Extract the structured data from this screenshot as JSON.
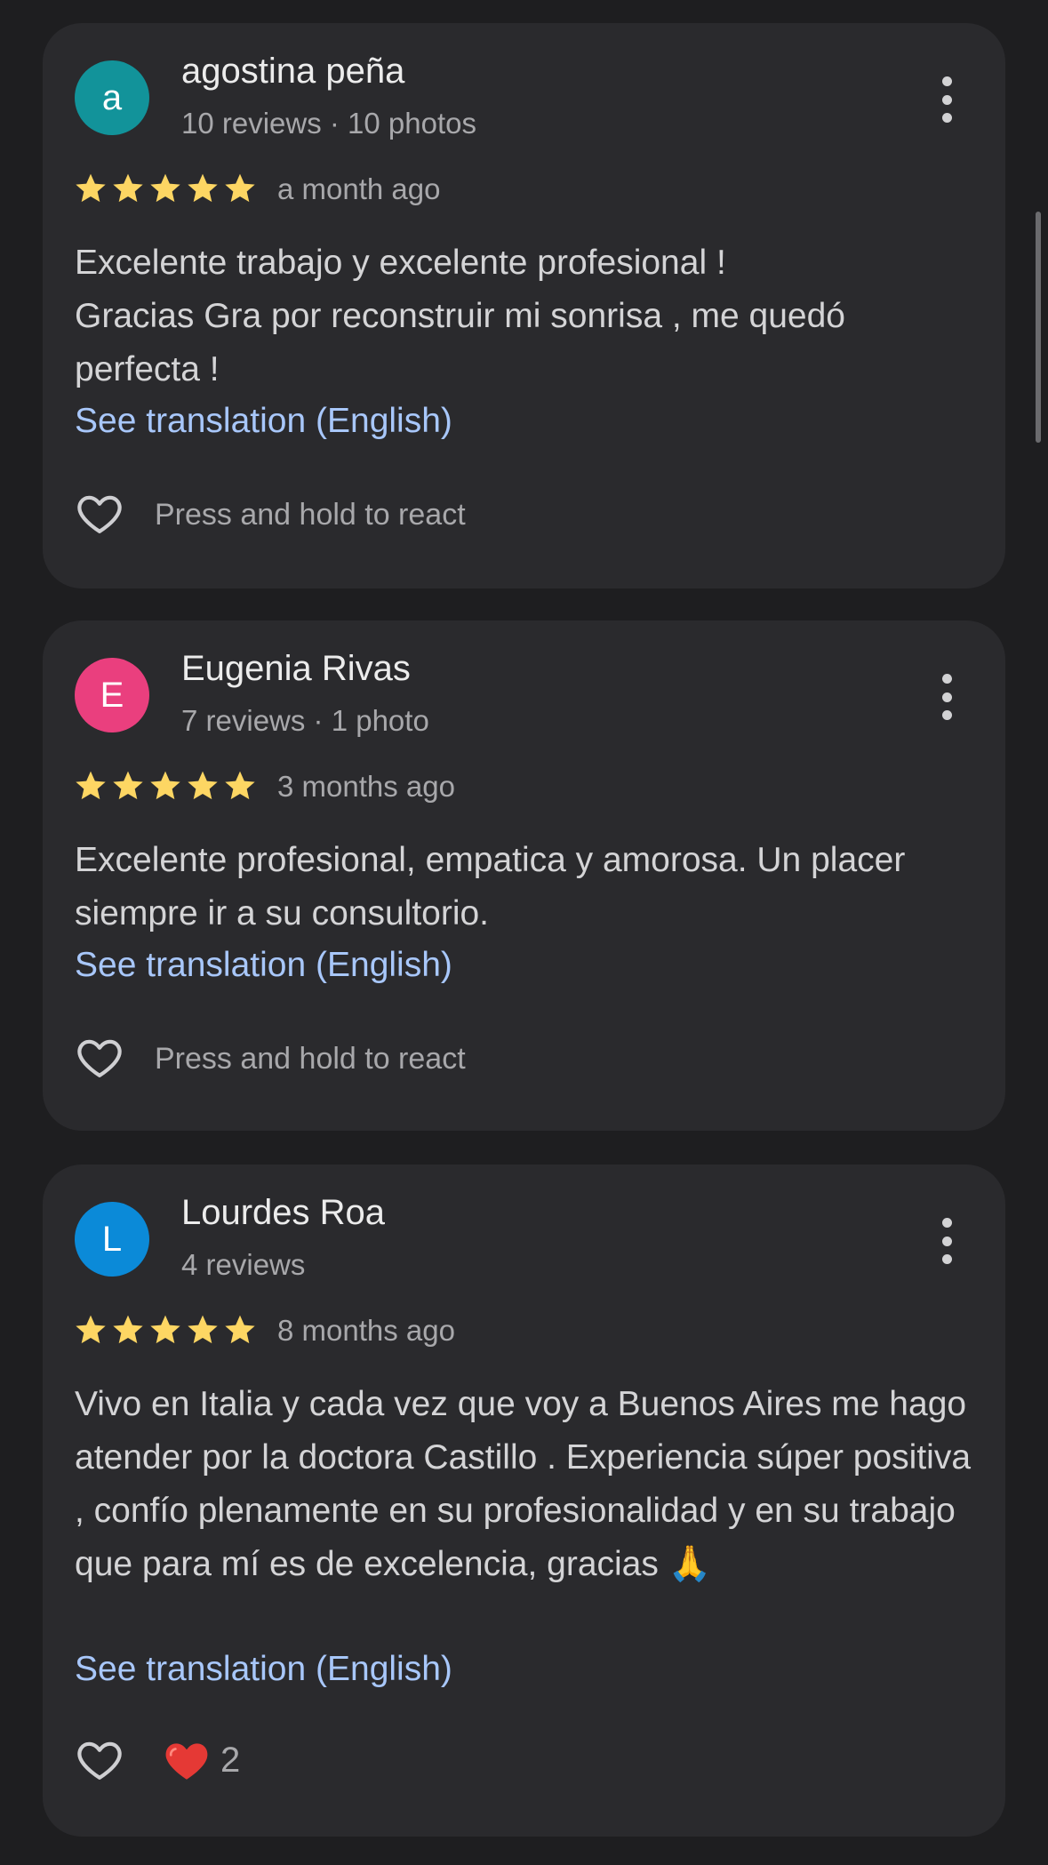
{
  "colors": {
    "background": "#1e1e20",
    "card": "#2a2a2d",
    "star": "#fdd663",
    "link": "#a8c7fa",
    "reaction_heart": "#e53935"
  },
  "reviews": [
    {
      "avatar_letter": "a",
      "avatar_color": "#12939a",
      "name": "agostina peña",
      "meta": "10 reviews · 10 photos",
      "rating": 5,
      "when": "a month ago",
      "text": "Excelente trabajo y excelente profesional !\nGracias Gra por reconstruir mi sonrisa , me quedó perfecta !",
      "translate_label": "See translation (English)",
      "react_label": "Press and hold to react",
      "more_icon": "more-vert-icon",
      "like_icon": "heart-outline-icon"
    },
    {
      "avatar_letter": "E",
      "avatar_color": "#ea3f7e",
      "name": "Eugenia Rivas",
      "meta": "7 reviews · 1 photo",
      "rating": 5,
      "when": "3 months ago",
      "text": "Excelente profesional, empatica y amorosa. Un placer siempre ir a su consultorio.",
      "translate_label": "See translation (English)",
      "react_label": "Press and hold to react",
      "more_icon": "more-vert-icon",
      "like_icon": "heart-outline-icon"
    },
    {
      "avatar_letter": "L",
      "avatar_color": "#0b8ad8",
      "name": "Lourdes Roa",
      "meta": "4 reviews",
      "rating": 5,
      "when": "8 months ago",
      "text": "Vivo en Italia y cada vez que voy a Buenos Aires me hago atender por la doctora Castillo . Experiencia súper positiva , confío plenamente en su profesionalidad y en su trabajo que para mí es de excelencia, gracias 🙏",
      "translate_label": "See translation (English)",
      "reaction": {
        "emoji": "❤️",
        "count": "2"
      },
      "more_icon": "more-vert-icon",
      "like_icon": "heart-outline-icon"
    }
  ]
}
